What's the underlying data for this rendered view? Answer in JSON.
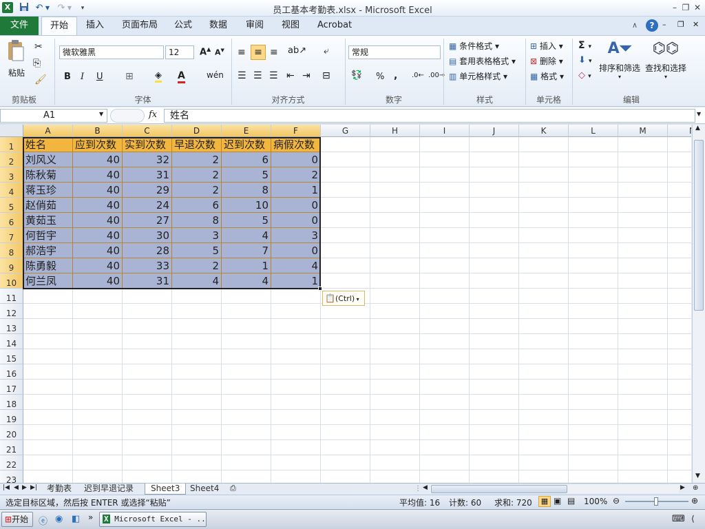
{
  "title_bar": {
    "title": "员工基本考勤表.xlsx  -  Microsoft Excel",
    "app_icon": "X",
    "undo_icon": "↶",
    "redo_icon": "↷",
    "save_icon": "💾",
    "minimize": "–",
    "restore": "❐",
    "close": "✕"
  },
  "ribbon_tabs": {
    "file": "文件",
    "tabs": [
      "开始",
      "插入",
      "页面布局",
      "公式",
      "数据",
      "审阅",
      "视图",
      "Acrobat"
    ]
  },
  "ribbon": {
    "clipboard": {
      "paste": "粘贴",
      "label": "剪贴板"
    },
    "font": {
      "name": "微软雅黑",
      "size": "12",
      "bold": "B",
      "italic": "I",
      "underline": "U",
      "label": "字体"
    },
    "alignment": {
      "label": "对齐方式"
    },
    "number": {
      "format": "常规",
      "percent": "%",
      "comma": ",",
      "label": "数字"
    },
    "styles": {
      "conditional": "条件格式",
      "table_format": "套用表格格式",
      "cell_styles": "单元格样式",
      "label": "样式"
    },
    "cells": {
      "insert": "插入",
      "delete": "删除",
      "format": "格式",
      "label": "单元格"
    },
    "editing": {
      "sum": "Σ",
      "sort_filter": "排序和筛选",
      "find_select": "查找和选择",
      "label": "编辑"
    }
  },
  "formula_bar": {
    "name_box": "A1",
    "fx": "fx",
    "content": "姓名"
  },
  "grid": {
    "columns": [
      "A",
      "B",
      "C",
      "D",
      "E",
      "F",
      "G",
      "H",
      "I",
      "J",
      "K",
      "L",
      "M",
      "N"
    ],
    "rows": [
      "1",
      "2",
      "3",
      "4",
      "5",
      "6",
      "7",
      "8",
      "9",
      "10",
      "11",
      "12",
      "13",
      "14",
      "15",
      "16",
      "17",
      "18",
      "19",
      "20",
      "21",
      "22",
      "23"
    ],
    "header_row": [
      "姓名",
      "应到次数",
      "实到次数",
      "早退次数",
      "迟到次数",
      "病假次数"
    ],
    "data": [
      [
        "刘风义",
        "40",
        "32",
        "2",
        "6",
        "0"
      ],
      [
        "陈秋菊",
        "40",
        "31",
        "2",
        "5",
        "2"
      ],
      [
        "蒋玉珍",
        "40",
        "29",
        "2",
        "8",
        "1"
      ],
      [
        "赵俏茹",
        "40",
        "24",
        "6",
        "10",
        "0"
      ],
      [
        "黄茹玉",
        "40",
        "27",
        "8",
        "5",
        "0"
      ],
      [
        "何哲宇",
        "40",
        "30",
        "3",
        "4",
        "3"
      ],
      [
        "郝浩宇",
        "40",
        "28",
        "5",
        "7",
        "0"
      ],
      [
        "陈勇毅",
        "40",
        "33",
        "2",
        "1",
        "4"
      ],
      [
        "何兰凤",
        "40",
        "31",
        "4",
        "4",
        "1"
      ]
    ],
    "paste_options": "(Ctrl)"
  },
  "sheets": {
    "tabs": [
      "考勤表",
      "迟到早退记录",
      "Sheet3",
      "Sheet4"
    ],
    "active": "Sheet3"
  },
  "status": {
    "message": "选定目标区域，然后按 ENTER 或选择“粘贴”",
    "average": "平均值: 16",
    "count": "计数: 60",
    "sum": "求和: 720",
    "zoom": "100%"
  },
  "taskbar": {
    "start": "开始",
    "window": "Microsoft Excel - ..."
  }
}
